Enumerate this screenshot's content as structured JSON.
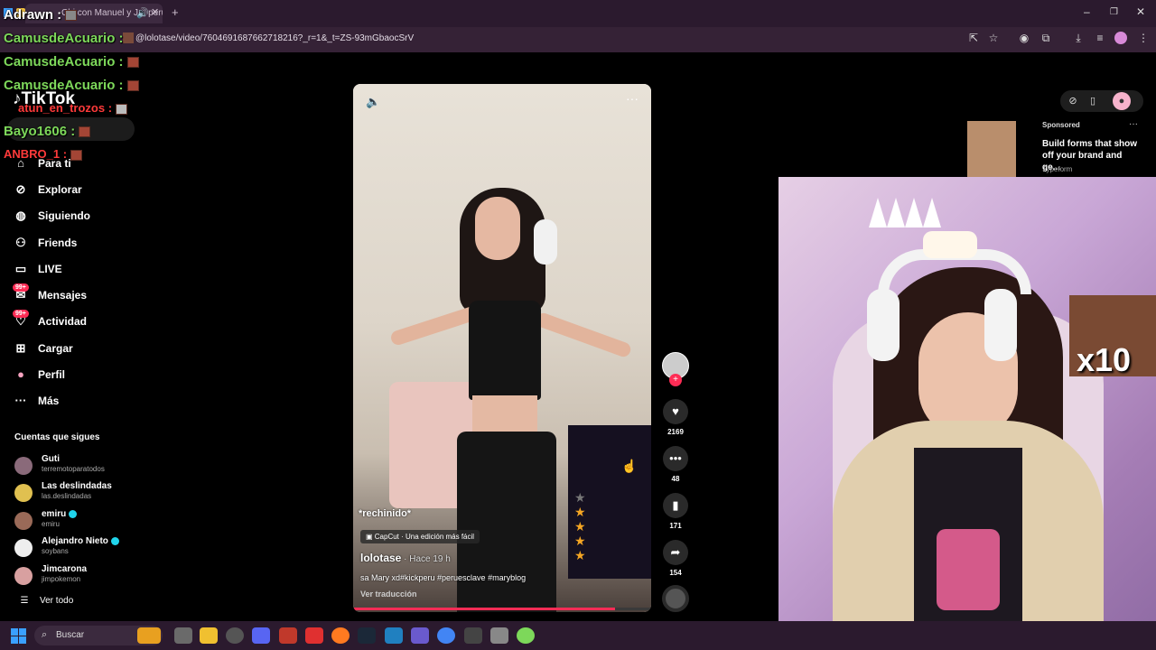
{
  "browser": {
    "tab_title": "Chi con Manuel y J... peru",
    "url": "@lolotase/video/7604691687662718216?_r=1&_t=ZS-93mGbaocSrV"
  },
  "chat": [
    {
      "user": "Adrawn",
      "sep": " : "
    },
    {
      "user": "CamusdeAcuario",
      "sep": " : "
    },
    {
      "user": "CamusdeAcuario",
      "sep": " : "
    },
    {
      "user": "CamusdeAcuario",
      "sep": " : "
    },
    {
      "user": "atun_en_trozos",
      "sep": " : "
    },
    {
      "user": "Bayo1606",
      "sep": " : "
    },
    {
      "user": "ANBRO_1",
      "sep": " : "
    }
  ],
  "tiktok": {
    "logo": "TikTok",
    "nav": [
      {
        "label": "Para ti",
        "icon": "home-icon"
      },
      {
        "label": "Explorar",
        "icon": "compass-icon"
      },
      {
        "label": "Siguiendo",
        "icon": "following-icon"
      },
      {
        "label": "Friends",
        "icon": "friends-icon"
      },
      {
        "label": "LIVE",
        "icon": "live-icon"
      },
      {
        "label": "Mensajes",
        "icon": "messages-icon",
        "badge": "99+"
      },
      {
        "label": "Actividad",
        "icon": "activity-icon",
        "badge": "99+"
      },
      {
        "label": "Cargar",
        "icon": "upload-icon"
      },
      {
        "label": "Perfil",
        "icon": "profile-icon"
      },
      {
        "label": "Más",
        "icon": "more-icon"
      }
    ],
    "following_title": "Cuentas que sigues",
    "following": [
      {
        "name": "Guti",
        "user": "terremotoparatodos",
        "verified": false
      },
      {
        "name": "Las deslindadas",
        "user": "las.deslindadas",
        "verified": false
      },
      {
        "name": "emiru",
        "user": "emiru",
        "verified": true
      },
      {
        "name": "Alejandro Nieto",
        "user": "soybans",
        "verified": true
      },
      {
        "name": "Jimcarona",
        "user": "jimpokemon",
        "verified": false
      }
    ],
    "see_all": "Ver todo"
  },
  "video": {
    "caption_overlay": "*rechinido*",
    "capcut": "CapCut · Una edición más fácil",
    "author": "lolotase",
    "time": " · Hace 19 h",
    "description": "sa Mary xd#kickperu #peruesclave #maryblog",
    "translate": "Ver traducción",
    "progress": 0.88
  },
  "actions": [
    {
      "icon": "heart-icon",
      "count": "2169"
    },
    {
      "icon": "comment-icon",
      "count": "48"
    },
    {
      "icon": "bookmark-icon",
      "count": "171"
    },
    {
      "icon": "share-icon",
      "count": "154"
    }
  ],
  "ad": {
    "sponsored": "Sponsored",
    "title": "Build forms that show off your brand and ge...",
    "brand": "Typeform"
  },
  "overlay": {
    "multiplier": "x10"
  },
  "taskbar": {
    "search": "Buscar"
  },
  "colors": {
    "accent": "#fe2c55",
    "chat_green": "#7dd85a",
    "chat_red": "#ff3a3a"
  }
}
